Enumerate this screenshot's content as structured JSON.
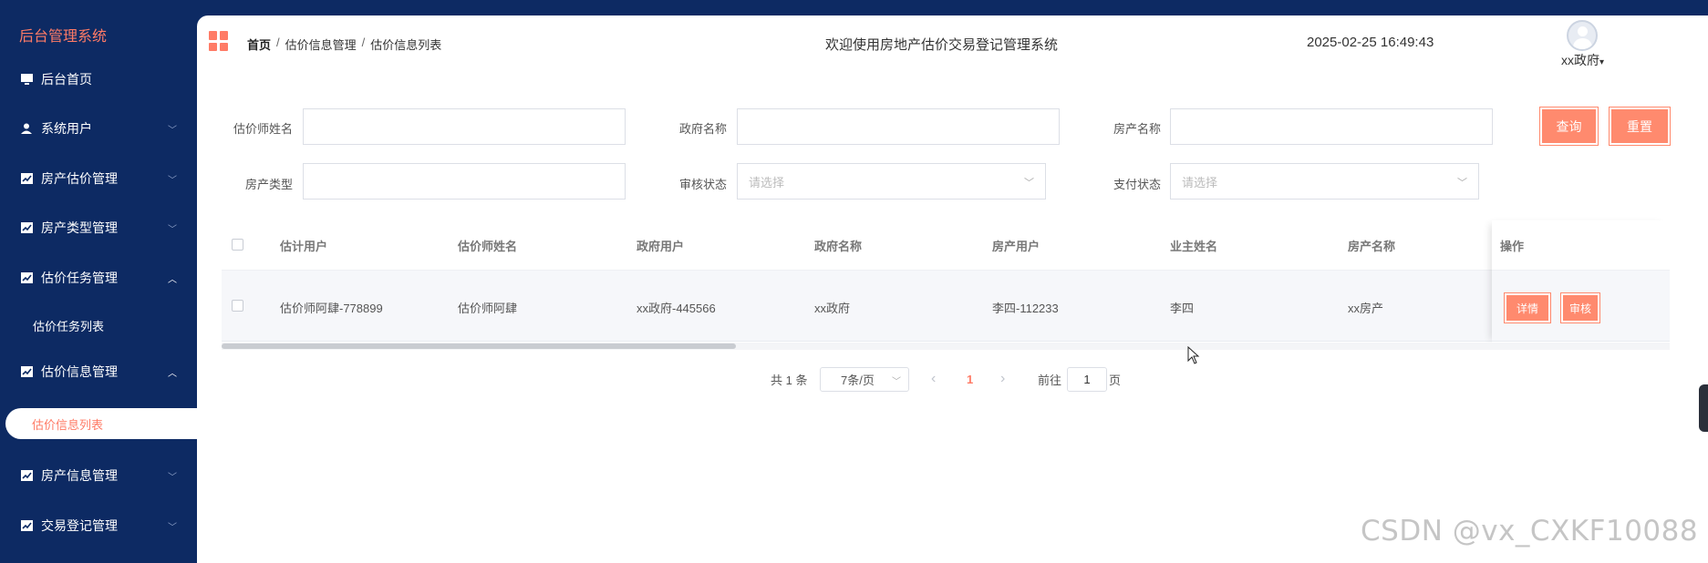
{
  "sidebar": {
    "logo": "后台管理系统",
    "items": [
      {
        "label": "后台首页",
        "icon": "monitor-icon"
      },
      {
        "label": "系统用户",
        "icon": "user-icon"
      },
      {
        "label": "房产估价管理",
        "icon": "chart-icon"
      },
      {
        "label": "房产类型管理",
        "icon": "chart-icon"
      },
      {
        "label": "估价任务管理",
        "icon": "chart-icon"
      },
      {
        "label": "估价信息管理",
        "icon": "chart-icon"
      },
      {
        "label": "房产信息管理",
        "icon": "chart-icon"
      },
      {
        "label": "交易登记管理",
        "icon": "chart-icon"
      }
    ],
    "sub_items": {
      "task_list": "估价任务列表",
      "info_list": "估价信息列表"
    }
  },
  "header": {
    "breadcrumb": [
      "首页",
      "估价信息管理",
      "估价信息列表"
    ],
    "breadcrumb_sep": "/",
    "welcome": "欢迎使用房地产估价交易登记管理系统",
    "datetime": "2025-02-25 16:49:43",
    "user": "xx政府",
    "user_caret": "▾"
  },
  "search": {
    "appraiser_label": "估价师姓名",
    "appraiser_value": "",
    "gov_label": "政府名称",
    "gov_value": "",
    "property_label": "房产名称",
    "property_value": "",
    "type_label": "房产类型",
    "type_value": "",
    "audit_label": "审核状态",
    "audit_placeholder": "请选择",
    "pay_label": "支付状态",
    "pay_placeholder": "请选择",
    "query_btn": "查询",
    "reset_btn": "重置"
  },
  "table": {
    "columns": [
      "估计用户",
      "估价师姓名",
      "政府用户",
      "政府名称",
      "房产用户",
      "业主姓名",
      "房产名称",
      "操作"
    ],
    "rows": [
      {
        "c1": "估价师阿肆-778899",
        "c2": "估价师阿肆",
        "c3": "xx政府-445566",
        "c4": "xx政府",
        "c5": "李四-112233",
        "c6": "李四",
        "c7": "xx房产"
      }
    ],
    "detail_btn": "详情",
    "audit_btn": "审核"
  },
  "pagination": {
    "total": "共 1 条",
    "page_size": "7条/页",
    "current": "1",
    "goto_label": "前往",
    "goto_value": "1",
    "page_suffix": "页",
    "prev": "‹",
    "next": "›"
  },
  "watermark": "CSDN @vx_CXKF10088",
  "colors": {
    "accent": "#ff8a6e",
    "sidebar": "#0d2a63"
  }
}
